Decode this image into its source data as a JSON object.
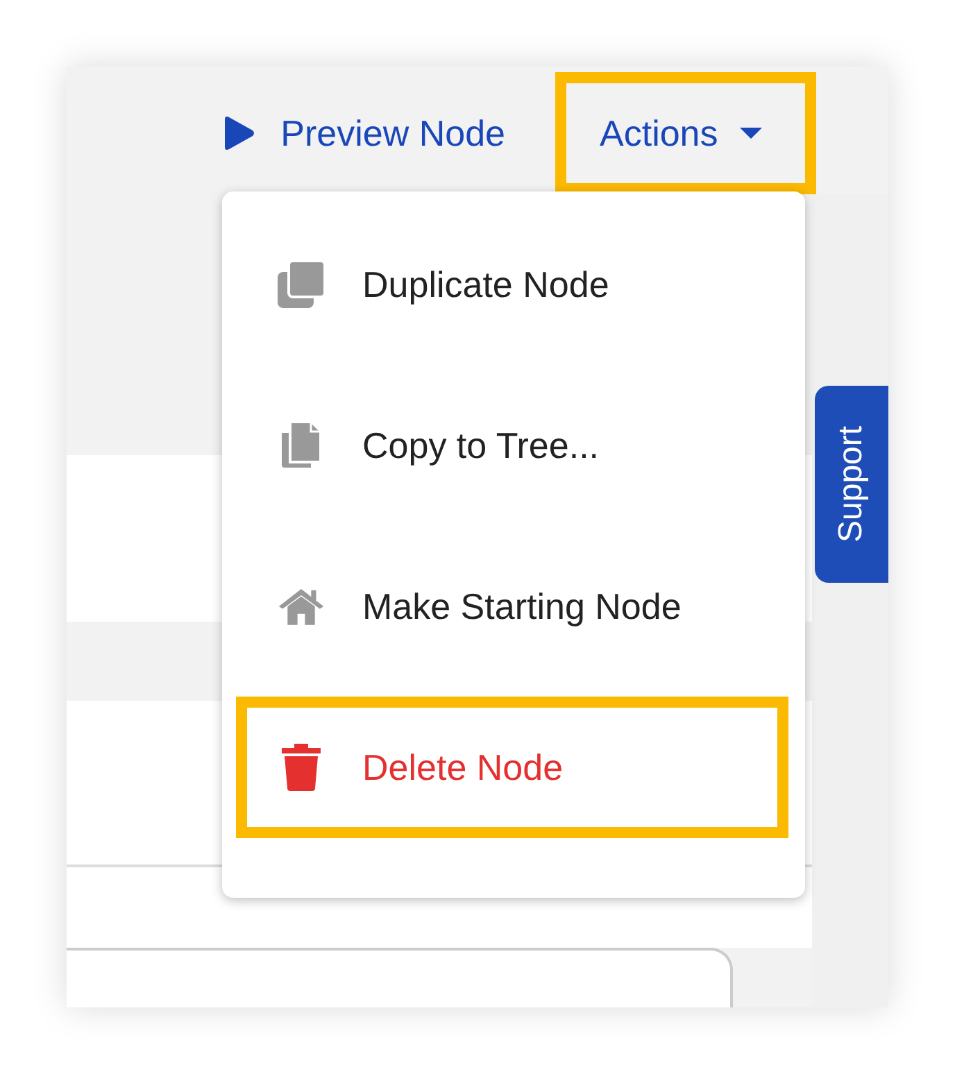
{
  "header": {
    "preview_link": "Preview Node",
    "actions_button": {
      "label": "Actions",
      "highlighted": true,
      "expanded": true
    }
  },
  "actions_menu": [
    {
      "kind": "duplicate",
      "label": "Duplicate Node",
      "danger": false,
      "highlighted": false
    },
    {
      "kind": "copy",
      "label": "Copy to Tree...",
      "danger": false,
      "highlighted": false
    },
    {
      "kind": "home",
      "label": "Make Starting Node",
      "danger": false,
      "highlighted": false
    },
    {
      "kind": "delete",
      "label": "Delete Node",
      "danger": true,
      "highlighted": true
    }
  ],
  "support_tab": "Support"
}
